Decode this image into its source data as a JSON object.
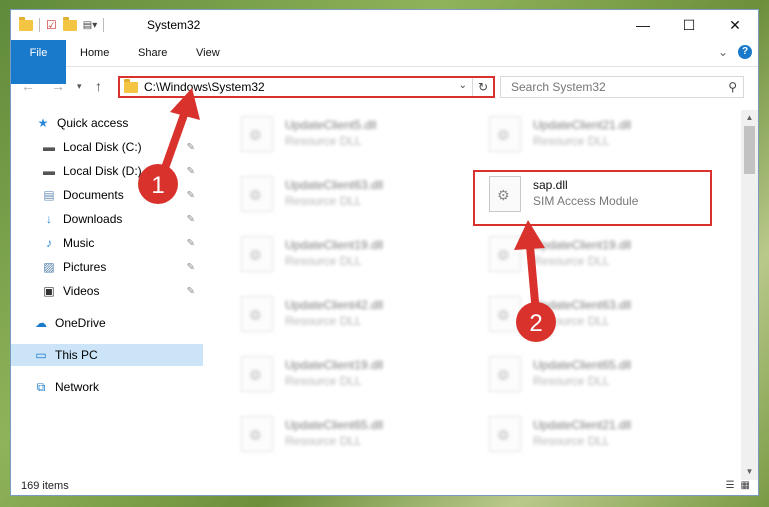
{
  "window": {
    "title": "System32",
    "controls": {
      "minimize": "—",
      "maximize": "☐",
      "close": "✕"
    }
  },
  "ribbon": {
    "tabs": [
      "File",
      "Home",
      "Share",
      "View"
    ],
    "collapse_glyph": "⌄",
    "help_glyph": "?"
  },
  "address": {
    "path": "C:\\Windows\\System32",
    "dropdown_glyph": "⌄",
    "refresh_glyph": "↻"
  },
  "search": {
    "placeholder": "Search System32",
    "icon": "search-icon"
  },
  "sidebar": {
    "items": [
      {
        "label": "Quick access",
        "icon": "star-icon",
        "glyph": "★",
        "pinned": false
      },
      {
        "label": "Local Disk (C:)",
        "icon": "drive-icon",
        "glyph": "▬",
        "pinned": true
      },
      {
        "label": "Local Disk (D:)",
        "icon": "drive-icon",
        "glyph": "▬",
        "pinned": true
      },
      {
        "label": "Documents",
        "icon": "documents-icon",
        "glyph": "▤",
        "pinned": true
      },
      {
        "label": "Downloads",
        "icon": "downloads-icon",
        "glyph": "↓",
        "pinned": true
      },
      {
        "label": "Music",
        "icon": "music-icon",
        "glyph": "♪",
        "pinned": true
      },
      {
        "label": "Pictures",
        "icon": "pictures-icon",
        "glyph": "▨",
        "pinned": true
      },
      {
        "label": "Videos",
        "icon": "videos-icon",
        "glyph": "▣",
        "pinned": true
      },
      {
        "label": "OneDrive",
        "icon": "cloud-icon",
        "glyph": "☁",
        "pinned": false
      },
      {
        "label": "This PC",
        "icon": "computer-icon",
        "glyph": "▭",
        "pinned": false,
        "selected": true
      },
      {
        "label": "Network",
        "icon": "network-icon",
        "glyph": "⧉",
        "pinned": false
      }
    ],
    "pin_glyph": "✎"
  },
  "files": {
    "left_column": [
      {
        "name": "UpdateClient5.dll",
        "type": "Resource DLL"
      },
      {
        "name": "UpdateClient63.dll",
        "type": "Resource DLL"
      },
      {
        "name": "UpdateClient19.dll",
        "type": "Resource DLL"
      },
      {
        "name": "UpdateClient42.dll",
        "type": "Resource DLL"
      },
      {
        "name": "UpdateClient19.dll",
        "type": "Resource DLL"
      },
      {
        "name": "UpdateClient65.dll",
        "type": "Resource DLL"
      }
    ],
    "right_column": [
      {
        "name": "UpdateClient21.dll",
        "type": "Resource DLL"
      },
      {
        "name": "sap.dll",
        "type": "SIM Access Module",
        "highlighted": true
      },
      {
        "name": "UpdateClient19.dll",
        "type": "Resource DLL"
      },
      {
        "name": "UpdateClient63.dll",
        "type": "Resource DLL"
      },
      {
        "name": "UpdateClient65.dll",
        "type": "Resource DLL"
      },
      {
        "name": "UpdateClient21.dll",
        "type": "Resource DLL"
      }
    ]
  },
  "status": {
    "item_count": "169 items"
  },
  "annotations": {
    "step1": "1",
    "step2": "2",
    "color": "#d9322d"
  }
}
